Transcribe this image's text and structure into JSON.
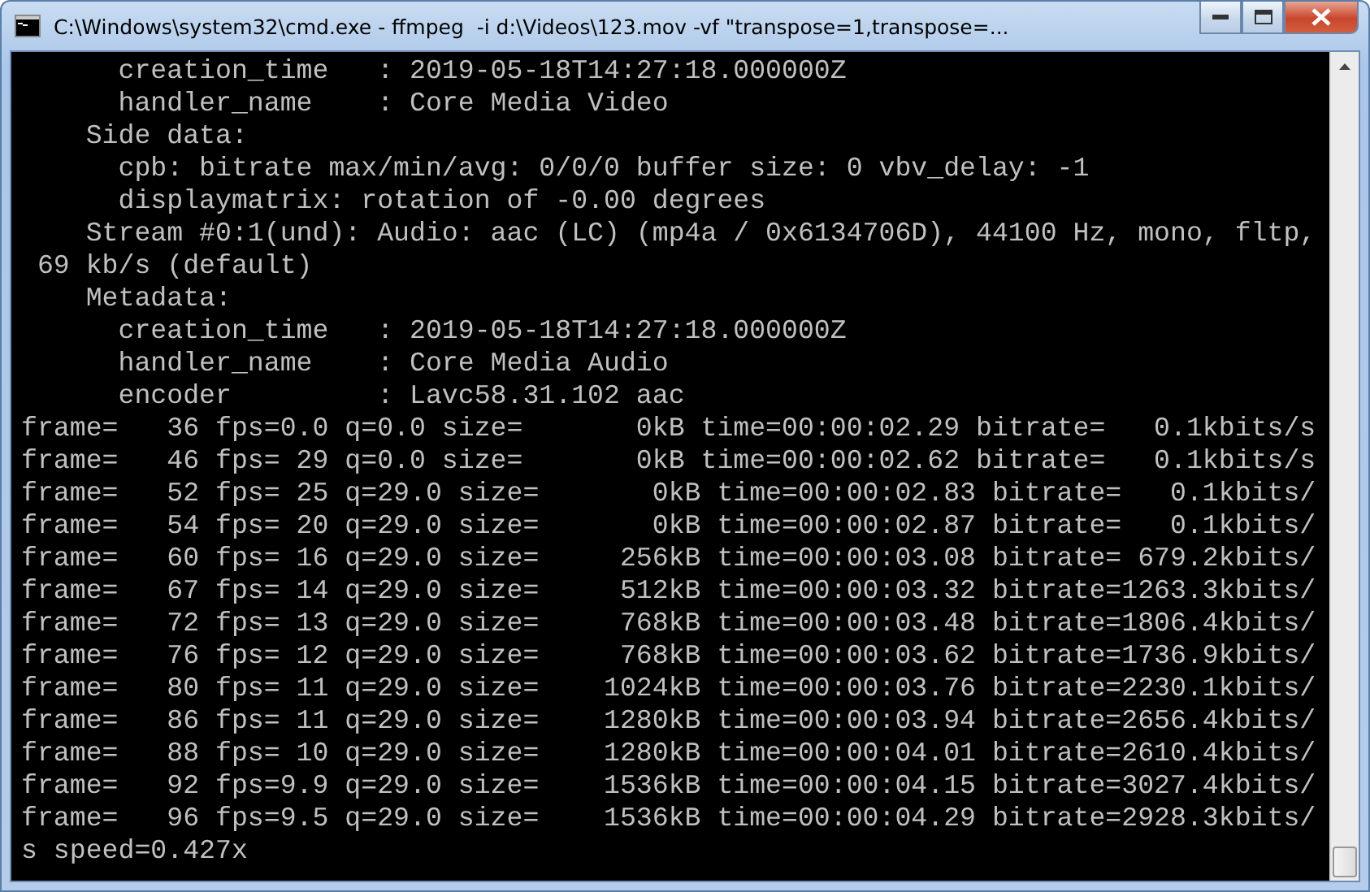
{
  "window": {
    "title": "C:\\Windows\\system32\\cmd.exe - ffmpeg  -i d:\\Videos\\123.mov -vf \"transpose=1,transpose=..."
  },
  "console": {
    "lines": [
      "      creation_time   : 2019-05-18T14:27:18.000000Z",
      "      handler_name    : Core Media Video",
      "    Side data:",
      "      cpb: bitrate max/min/avg: 0/0/0 buffer size: 0 vbv_delay: -1",
      "      displaymatrix: rotation of -0.00 degrees",
      "    Stream #0:1(und): Audio: aac (LC) (mp4a / 0x6134706D), 44100 Hz, mono, fltp,",
      " 69 kb/s (default)",
      "    Metadata:",
      "      creation_time   : 2019-05-18T14:27:18.000000Z",
      "      handler_name    : Core Media Audio",
      "      encoder         : Lavc58.31.102 aac",
      "frame=   36 fps=0.0 q=0.0 size=       0kB time=00:00:02.29 bitrate=   0.1kbits/s",
      "frame=   46 fps= 29 q=0.0 size=       0kB time=00:00:02.62 bitrate=   0.1kbits/s",
      "frame=   52 fps= 25 q=29.0 size=       0kB time=00:00:02.83 bitrate=   0.1kbits/",
      "frame=   54 fps= 20 q=29.0 size=       0kB time=00:00:02.87 bitrate=   0.1kbits/",
      "frame=   60 fps= 16 q=29.0 size=     256kB time=00:00:03.08 bitrate= 679.2kbits/",
      "frame=   67 fps= 14 q=29.0 size=     512kB time=00:00:03.32 bitrate=1263.3kbits/",
      "frame=   72 fps= 13 q=29.0 size=     768kB time=00:00:03.48 bitrate=1806.4kbits/",
      "frame=   76 fps= 12 q=29.0 size=     768kB time=00:00:03.62 bitrate=1736.9kbits/",
      "frame=   80 fps= 11 q=29.0 size=    1024kB time=00:00:03.76 bitrate=2230.1kbits/",
      "frame=   86 fps= 11 q=29.0 size=    1280kB time=00:00:03.94 bitrate=2656.4kbits/",
      "frame=   88 fps= 10 q=29.0 size=    1280kB time=00:00:04.01 bitrate=2610.4kbits/",
      "frame=   92 fps=9.9 q=29.0 size=    1536kB time=00:00:04.15 bitrate=3027.4kbits/",
      "frame=   96 fps=9.5 q=29.0 size=    1536kB time=00:00:04.29 bitrate=2928.3kbits/",
      "s speed=0.427x"
    ]
  }
}
